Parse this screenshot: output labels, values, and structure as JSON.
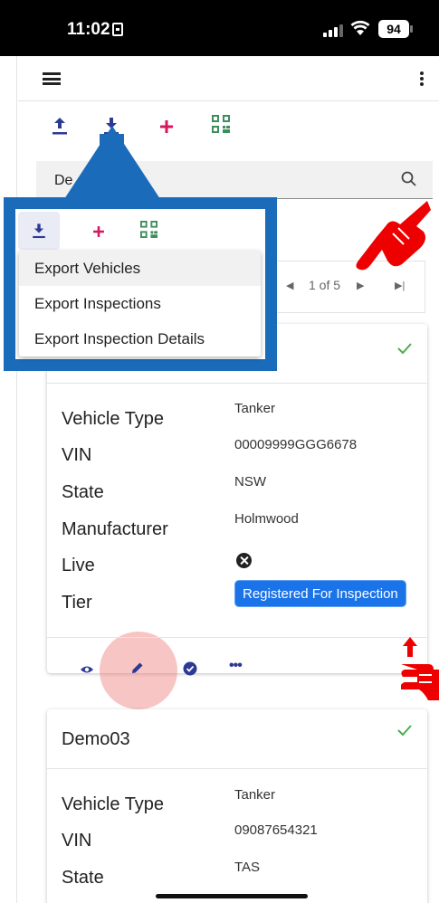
{
  "status_bar": {
    "time": "11:02",
    "battery": "94"
  },
  "search": {
    "value": "De"
  },
  "pagination": {
    "text": "1 of 5"
  },
  "export_menu": {
    "items": [
      "Export Vehicles",
      "Export Inspections",
      "Export Inspection Details"
    ]
  },
  "cards": [
    {
      "title": "",
      "fields": [
        {
          "label": "Vehicle Type",
          "value": "Tanker"
        },
        {
          "label": "VIN",
          "value": "00009999GGG6678"
        },
        {
          "label": "State",
          "value": "NSW"
        },
        {
          "label": "Manufacturer",
          "value": "Holmwood"
        },
        {
          "label": "Live",
          "value": ""
        },
        {
          "label": "Tier",
          "value": "Registered For Inspection"
        }
      ]
    },
    {
      "title": "Demo03",
      "fields": [
        {
          "label": "Vehicle Type",
          "value": "Tanker"
        },
        {
          "label": "VIN",
          "value": "09087654321"
        },
        {
          "label": "State",
          "value": "TAS"
        }
      ]
    }
  ],
  "colors": {
    "primary": "#2c3a94",
    "accent": "#d3185f",
    "chip": "#1a73e8",
    "callout": "#1a6cbb",
    "check": "#4caf50"
  },
  "icons": [
    "menu-icon",
    "more-vert-icon",
    "upload-icon",
    "download-icon",
    "add-icon",
    "qr-code-icon",
    "search-icon",
    "check-icon",
    "close-circle-icon",
    "eye-icon",
    "pencil-icon",
    "check-circle-icon",
    "more-horiz-icon"
  ]
}
